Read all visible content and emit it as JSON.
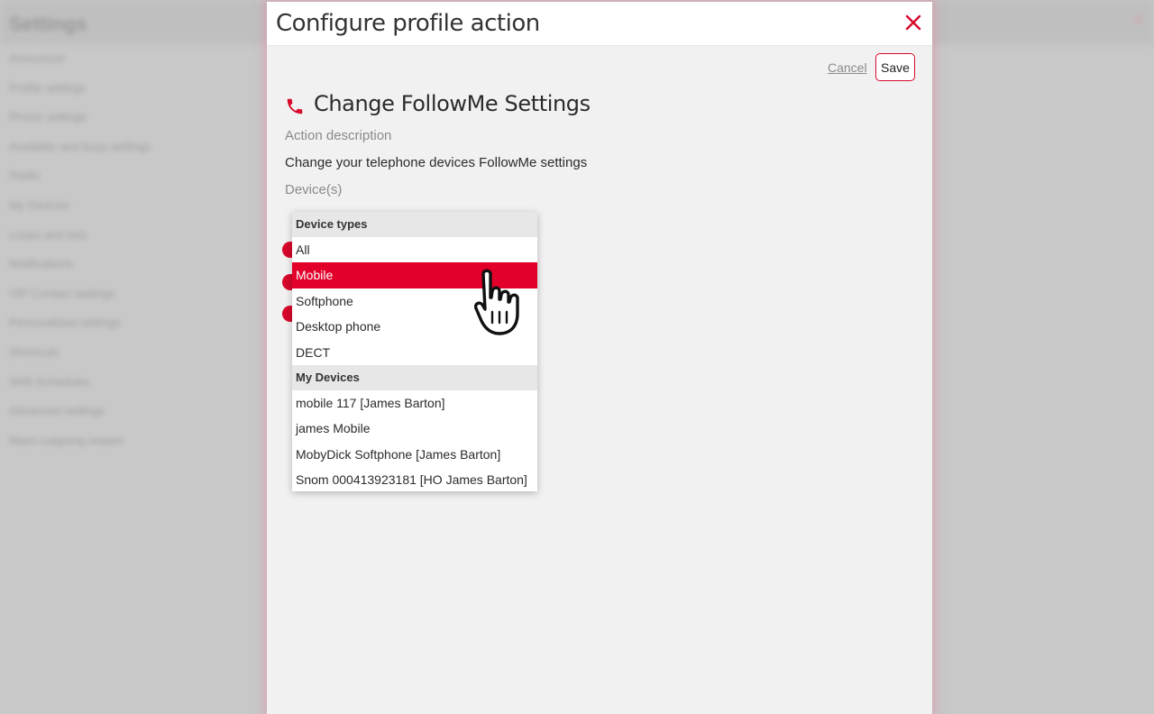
{
  "background": {
    "title": "Settings",
    "menu": [
      "Announcer",
      "Profile settings",
      "Phone settings",
      "Available and busy settings",
      "Radio",
      "My Devices",
      "Loops and lists",
      "Notifications",
      "VIP Contact settings",
      "Personalised settings",
      "Shortcuts",
      "Shift Schedules",
      "Advanced settings",
      "Mass outgoing instant"
    ]
  },
  "modal": {
    "title": "Configure profile action",
    "cancel_label": "Cancel",
    "save_label": "Save",
    "action_title": "Change FollowMe Settings",
    "action_description_label": "Action description",
    "action_description": "Change your telephone devices FollowMe settings",
    "devices_label": "Device(s)"
  },
  "dropdown": {
    "groups": [
      {
        "header": "Device types",
        "options": [
          "All",
          "Mobile",
          "Softphone",
          "Desktop phone",
          "DECT"
        ]
      },
      {
        "header": "My Devices",
        "options": [
          "mobile 117 [James Barton]",
          "james Mobile",
          "MobyDick Softphone [James Barton]",
          "Snom 000413923181 [HO James Barton]"
        ]
      }
    ],
    "selected": "Mobile"
  },
  "colors": {
    "accent": "#e2002a",
    "modal_bg": "#f1f1f1",
    "overlay": "#c8c8c8"
  },
  "icons": {
    "close": "close-icon",
    "phone": "phone-icon",
    "cursor": "hand-pointer-icon"
  }
}
